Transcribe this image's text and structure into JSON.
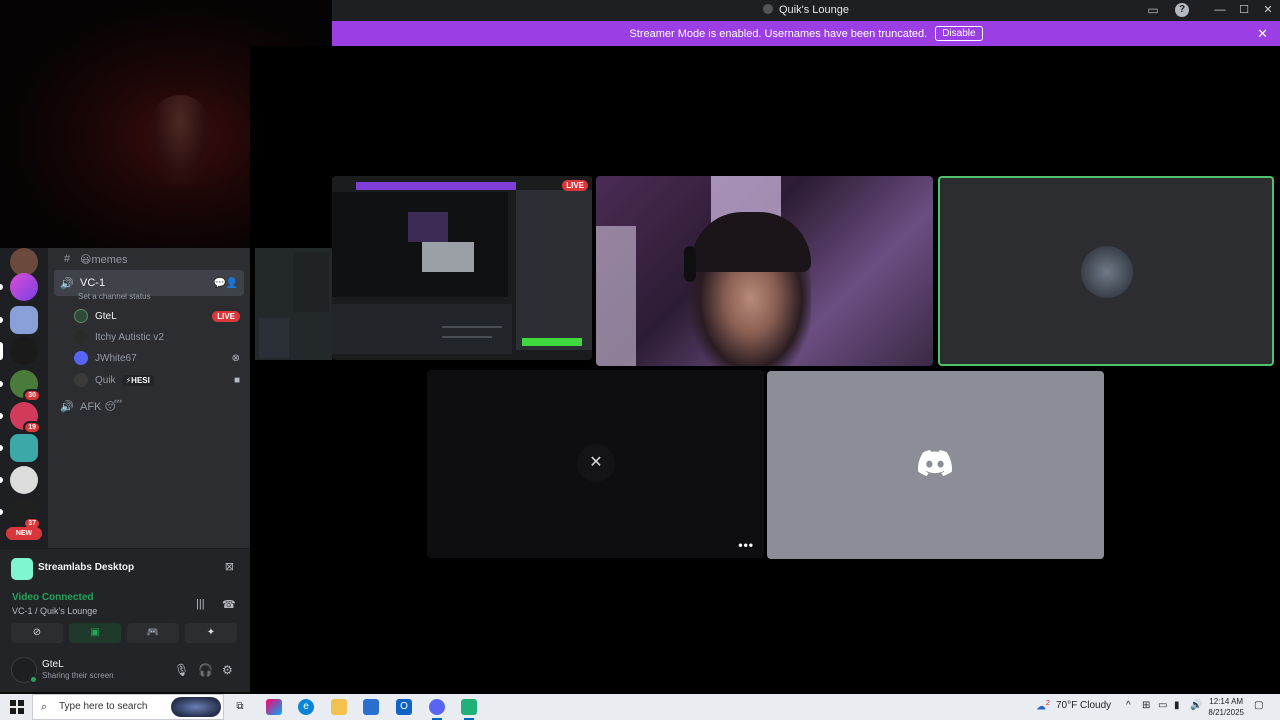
{
  "window": {
    "title": "Quik's Lounge",
    "controls": [
      "—",
      "☐",
      "✕"
    ]
  },
  "banner": {
    "text": "Streamer Mode is enabled. Usernames have been truncated.",
    "button": "Disable"
  },
  "servers": [
    {
      "badge": ""
    },
    {
      "badge": ""
    },
    {
      "badge": ""
    },
    {
      "badge": ""
    },
    {
      "badge": "30"
    },
    {
      "badge": "19"
    },
    {
      "badge": ""
    },
    {
      "badge": ""
    },
    {
      "badge": "37"
    }
  ],
  "new_badge": "NEW",
  "channels": {
    "memes": "😃memes",
    "vc1": "VC-1",
    "vc1_status": "Set a channel status",
    "afk": "AFK 😴",
    "members": [
      {
        "name": "GteL",
        "live": "LIVE",
        "tag": ""
      },
      {
        "name": "Itchy Autistic v2",
        "live": "",
        "tag": ""
      },
      {
        "name": "JWhite67",
        "live": "",
        "tag": ""
      },
      {
        "name": "Quik",
        "live": "",
        "tag": "⚡HESI"
      }
    ]
  },
  "activity": {
    "name": "Streamlabs Desktop"
  },
  "voice": {
    "status": "Video Connected",
    "channel": "VC-1 / Quik's Lounge"
  },
  "user": {
    "name": "GteL",
    "status": "Sharing their screen"
  },
  "stream_tile": {
    "live": "LIVE"
  },
  "taskbar": {
    "search_placeholder": "Type here to search",
    "weather": "70°F  Cloudy",
    "weather_badge": "2",
    "time": "12:14 AM",
    "date": "8/21/2025"
  },
  "colors": {
    "accent_purple": "#9b3fe5",
    "speaking_green": "#4fc36b",
    "live_red": "#da373c",
    "connected_green": "#23a55a"
  }
}
